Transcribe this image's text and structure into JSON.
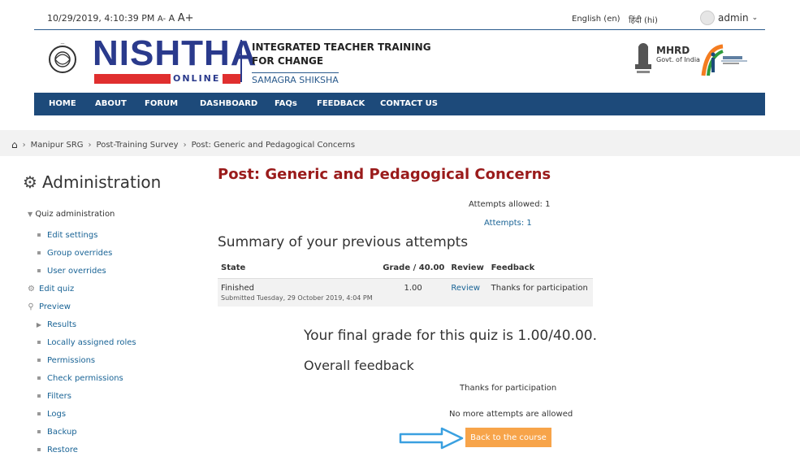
{
  "topbar": {
    "datetime": "10/29/2019, 4:10:39 PM",
    "font_small": "A-",
    "font_normal": "A",
    "font_large": "A+",
    "lang_en": "English (en)",
    "lang_hi": "हिंदी (hi)",
    "user": "admin"
  },
  "header": {
    "logo_main": "NISHTHA",
    "logo_sub": "ONLINE",
    "tagline_1": "INTEGRATED TEACHER TRAINING",
    "tagline_2": "FOR CHANGE",
    "tagline_3": "SAMAGRA SHIKSHA",
    "mhrd_title": "MHRD",
    "mhrd_sub": "Govt. of India",
    "brand_color": "#2a3a8c",
    "accent_color": "#e02f2f"
  },
  "nav": {
    "items": [
      "HOME",
      "ABOUT",
      "FORUM",
      "DASHBOARD",
      "FAQs",
      "FEEDBACK",
      "CONTACT US"
    ],
    "bg_color": "#1d4a7a"
  },
  "breadcrumb": {
    "items": [
      "Manipur SRG",
      "Post-Training Survey",
      "Post: Generic and Pedagogical Concerns"
    ]
  },
  "sidebar": {
    "title": "Administration",
    "section": "Quiz administration",
    "items": [
      {
        "label": "Edit settings",
        "icon": "bullet"
      },
      {
        "label": "Group overrides",
        "icon": "bullet"
      },
      {
        "label": "User overrides",
        "icon": "bullet"
      },
      {
        "label": "Edit quiz",
        "icon": "gear-icon"
      },
      {
        "label": "Preview",
        "icon": "search-icon"
      },
      {
        "label": "Results",
        "icon": "triangle-right-icon"
      },
      {
        "label": "Locally assigned roles",
        "icon": "bullet"
      },
      {
        "label": "Permissions",
        "icon": "bullet"
      },
      {
        "label": "Check permissions",
        "icon": "bullet"
      },
      {
        "label": "Filters",
        "icon": "bullet"
      },
      {
        "label": "Logs",
        "icon": "bullet"
      },
      {
        "label": "Backup",
        "icon": "bullet"
      },
      {
        "label": "Restore",
        "icon": "bullet"
      }
    ]
  },
  "main": {
    "heading": "Post: Generic and Pedagogical Concerns",
    "attempts_allowed": "Attempts allowed: 1",
    "attempts": "Attempts: 1",
    "summary_title": "Summary of your previous attempts",
    "table": {
      "headers": [
        "State",
        "Grade / 40.00",
        "Review",
        "Feedback"
      ],
      "rows": [
        {
          "state": "Finished",
          "submitted": "Submitted Tuesday, 29 October 2019, 4:04 PM",
          "grade": "1.00",
          "review": "Review",
          "feedback": "Thanks for participation"
        }
      ]
    },
    "final_grade": "Your final grade for this quiz is 1.00/40.00.",
    "overall_feedback_title": "Overall feedback",
    "overall_feedback_text": "Thanks for participation",
    "no_more": "No more attempts are allowed",
    "back_button": "Back to the course",
    "heading_color": "#9a1b1b",
    "button_color": "#f7a44a"
  }
}
